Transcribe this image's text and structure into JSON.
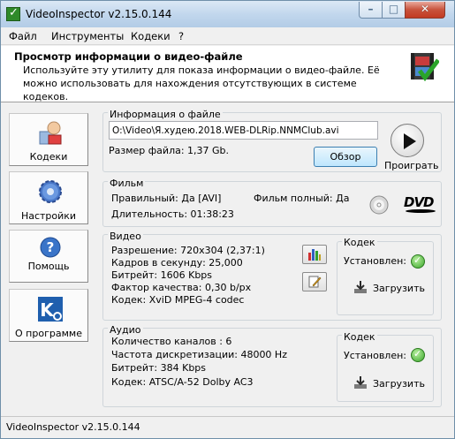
{
  "window": {
    "title": "VideoInspector v2.15.0.144"
  },
  "titlebar_buttons": {
    "minimize": "–",
    "maximize": "□",
    "close": "✕"
  },
  "menu": {
    "items": [
      "Файл",
      "Инструменты",
      "Кодеки",
      "?"
    ]
  },
  "header": {
    "title": "Просмотр информации о видео-файле",
    "description": "Используйте эту утилиту для показа информации о видео-файле. Её можно использовать для нахождения отсутствующих в системе кодеков.",
    "icon": "film-icon"
  },
  "sidebar": {
    "items": [
      {
        "label": "Кодеки",
        "icon": "codecs-icon"
      },
      {
        "label": "Настройки",
        "icon": "gear-icon"
      },
      {
        "label": "Помощь",
        "icon": "help-icon"
      },
      {
        "label": "О программе",
        "icon": "about-icon"
      }
    ]
  },
  "file_info": {
    "title": "Информация о файле",
    "path": "O:\\Video\\Я.худею.2018.WEB-DLRip.NNMClub.avi",
    "size_label": "Размер файла: 1,37 Gb.",
    "browse_label": "Обзор",
    "play_label": "Проиграть"
  },
  "film": {
    "title": "Фильм",
    "correct": "Правильный: Да [AVI]",
    "full": "Фильм полный: Да",
    "duration": "Длительность: 01:38:23",
    "dvd_label": "DVD"
  },
  "video": {
    "title": "Видео",
    "resolution": "Разрешение: 720x304 (2,37:1)",
    "fps": "Кадров в секунду: 25,000",
    "bitrate": "Битрейт: 1606 Kbps",
    "quality": "Фактор качества: 0,30 b/px",
    "codec": "Кодек: XviD MPEG-4 codec",
    "codec_group": {
      "title": "Кодек",
      "installed": "Установлен:",
      "download": "Загрузить"
    }
  },
  "audio": {
    "title": "Аудио",
    "channels": "Количество каналов : 6",
    "samplerate": "Частота дискретизации: 48000 Hz",
    "bitrate": "Битрейт: 384 Kbps",
    "codec": "Кодек: ATSC/A-52 Dolby AC3",
    "codec_group": {
      "title": "Кодек",
      "installed": "Установлен:",
      "download": "Загрузить"
    }
  },
  "status": {
    "text": "VideoInspector v2.15.0.144"
  },
  "colors": {
    "accent": "#3c7fb1",
    "ok": "#3aa52a",
    "titlebar": "#c2d7ed"
  }
}
